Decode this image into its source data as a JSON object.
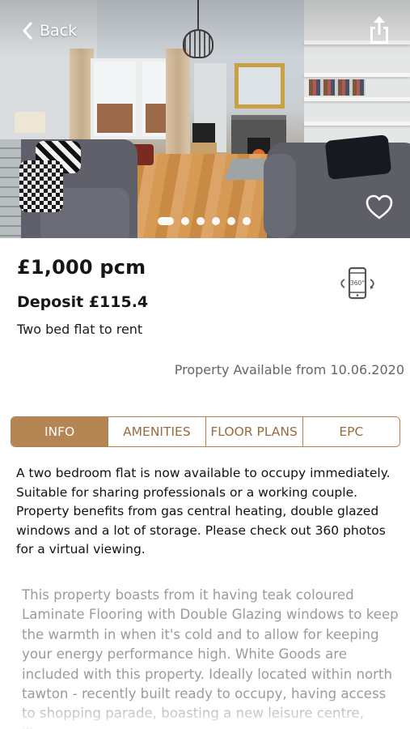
{
  "header": {
    "back_label": "Back",
    "back_icon": "chevron-left-icon",
    "share_icon": "share-icon"
  },
  "gallery": {
    "photo": "living room with grey sofas, fireplace, gold mirror and wooden floor",
    "favorite_icon": "heart-outline-icon",
    "dots_total": 6,
    "active_index": 0
  },
  "listing": {
    "price": "£1,000 pcm",
    "deposit": "Deposit £115.4",
    "title": "Two bed flat to rent",
    "vr_icon": "phone-360-icon",
    "availability": "Property Available from 10.06.2020"
  },
  "tabs": [
    {
      "label": "INFO",
      "active": true
    },
    {
      "label": "AMENITIES",
      "active": false
    },
    {
      "label": "FLOOR PLANS",
      "active": false
    },
    {
      "label": "EPC",
      "active": false
    }
  ],
  "info": {
    "description": "A two bedroom flat is now available to occupy immediately. Suitable for sharing professionals or a working couple. Property benefits from gas central heating, double glazed windows and a lot of storage. Please check out 360 photos for a virtual viewing.",
    "details": "This property boasts from it having teak coloured Laminate Flooring with Double Glazing windows to keep the warmth in when it's cold and to allow for keeping your energy performance high. White Goods are included with this property. Ideally located within north tawton - recently built ready to occupy, having access to shopping parade, boasting a new leisure centre, library"
  },
  "colors": {
    "accent": "#b58554",
    "accent_text": "#9a6b3d",
    "muted_text": "#9b9b9b"
  }
}
